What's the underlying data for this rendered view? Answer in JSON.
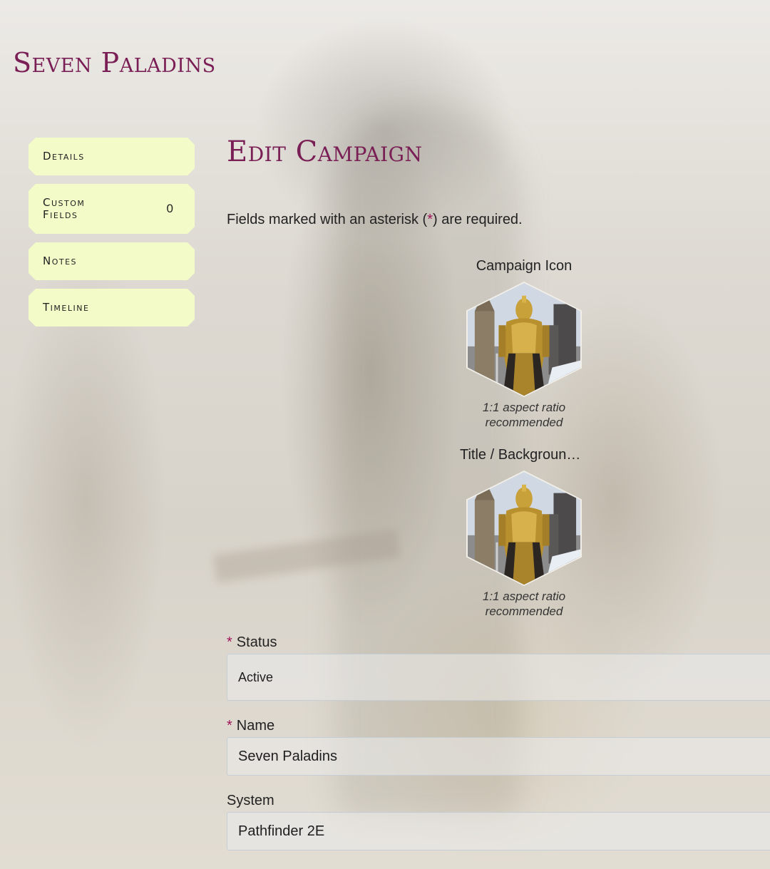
{
  "site": {
    "title": "Seven Paladins"
  },
  "nav": {
    "items": [
      {
        "label": "Details"
      },
      {
        "label": "Custom Fields",
        "count": "0"
      },
      {
        "label": "Notes"
      },
      {
        "label": "Timeline"
      }
    ]
  },
  "page": {
    "title": "Edit Campaign",
    "required_note_before": "Fields marked with an asterisk (",
    "required_note_asterisk": "*",
    "required_note_after": ") are required."
  },
  "images": {
    "icon": {
      "label": "Campaign Icon",
      "hint": "1:1 aspect ratio recommended"
    },
    "background": {
      "label": "Title / Background Image",
      "hint": "1:1 aspect ratio recommended"
    }
  },
  "form": {
    "status": {
      "label": "Status",
      "required_mark": "*",
      "value": "Active"
    },
    "name": {
      "label": "Name",
      "required_mark": "*",
      "value": "Seven Paladins"
    },
    "system": {
      "label": "System",
      "value": "Pathfinder 2E"
    }
  },
  "colors": {
    "brand": "#7a1f55",
    "nav_background": "#f3fbc8",
    "required": "#a0145a"
  },
  "icons": {
    "campaign_icon": "paladin-portrait",
    "background_image": "paladin-portrait"
  }
}
